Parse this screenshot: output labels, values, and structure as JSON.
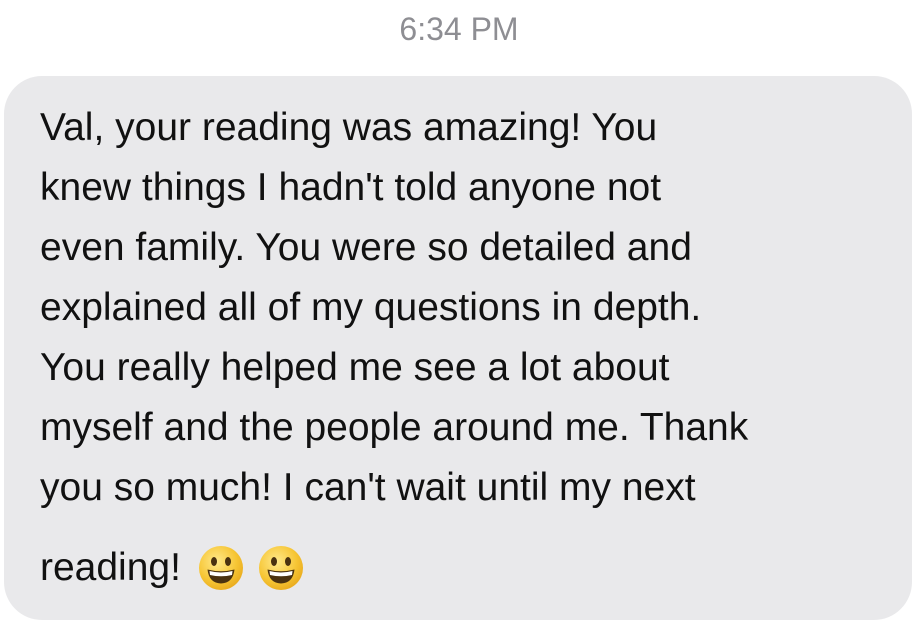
{
  "conversation": {
    "timestamp": "6:34 PM"
  },
  "message": {
    "lines": [
      "Val, your reading was amazing! You",
      "knew things I hadn't told anyone not",
      "even family. You were so detailed and",
      "explained all of my questions in depth.",
      "You really helped me see a lot about",
      "myself and the people around me. Thank",
      "you so much! I can't wait until my next",
      "reading!"
    ],
    "emojis": [
      "grinning-face-icon",
      "grinning-face-icon"
    ]
  },
  "colors": {
    "bubble_background": "#e9e9eb",
    "timestamp_text": "#8e8e93",
    "message_text": "#111111",
    "emoji_face": "#f6c534"
  }
}
